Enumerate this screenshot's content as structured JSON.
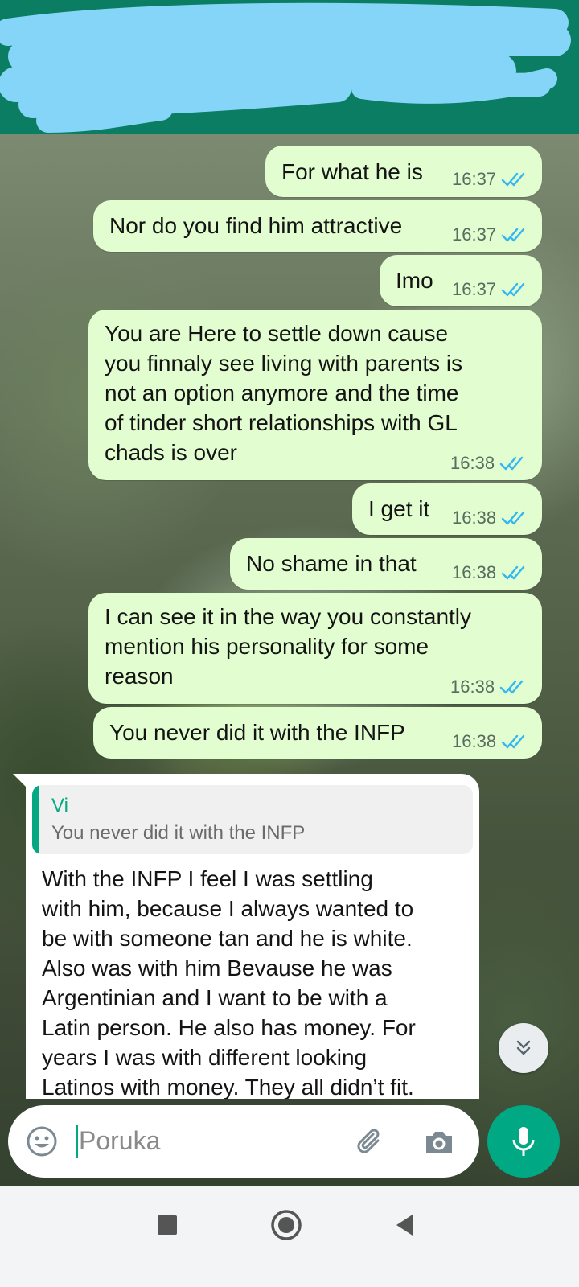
{
  "colors": {
    "header": "#0b7d62",
    "outgoing_bubble": "#e2fdd0",
    "incoming_bubble": "#ffffff",
    "accent": "#00a884",
    "read_tick": "#34b7f1"
  },
  "messages_out": [
    {
      "text": "For what he is",
      "time": "16:37"
    },
    {
      "text": "Nor do you find him attractive",
      "time": "16:37"
    },
    {
      "text": "Imo",
      "time": "16:37"
    },
    {
      "text": "You are Here to settle down cause\nyou finnaly see living with parents is\nnot an option anymore and the time\nof tinder short relationships with GL\nchads is over",
      "time": "16:38"
    },
    {
      "text": "I get it",
      "time": "16:38"
    },
    {
      "text": "No shame in that",
      "time": "16:38"
    },
    {
      "text": "I can see it in the way you constantly\nmention his personality for some\nreason",
      "time": "16:38"
    },
    {
      "text": "You never did it with the INFP",
      "time": "16:38"
    }
  ],
  "incoming": {
    "quote_name": "Vi",
    "quote_text": "You never did it with the INFP",
    "text": "With the INFP I feel I was settling\nwith him, because I always wanted to\nbe with someone tan and he is white.\nAlso was with him Bevause he was\nArgentinian and I want to be with a\nLatin person. He also has money. For\nyears I was with different looking\nLatinos with money. They all didn’t fit."
  },
  "input": {
    "placeholder": "Poruka"
  },
  "icons": {
    "emoji": "emoji-icon",
    "attach": "paperclip-icon",
    "camera": "camera-icon",
    "mic": "microphone-icon",
    "scroll": "chevron-double-down-icon"
  }
}
